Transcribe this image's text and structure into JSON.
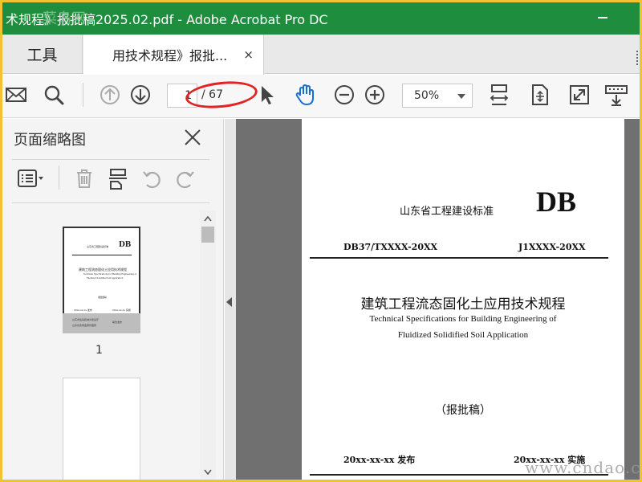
{
  "window": {
    "title": "术规程》报批稿2025.02.pdf - Adobe Acrobat Pro DC"
  },
  "tabs": {
    "tools_label": "工具",
    "doc_label": "用技术规程》报批...",
    "close_glyph": "×"
  },
  "toolbar": {
    "current_page": "1",
    "total_pages": "/ 67",
    "zoom": "50%"
  },
  "sidebar": {
    "title": "页面缩略图",
    "thumbnail_page_number": "1"
  },
  "page": {
    "standard_name": "山东省工程建设标准",
    "db_mark": "DB",
    "code_left": "DB37/TXXXX-20XX",
    "code_right": "J1XXXX-20XX",
    "title_cn": "建筑工程流态固化土应用技术规程",
    "title_en_line1": "Technical Specifications for Building Engineering of",
    "title_en_line2": "Fluidized Solidified Soil  Application",
    "draft_label": "（报批稿）",
    "issue_date": "20xx-xx-xx  发布",
    "impl_date": "20xx-xx-xx  实施"
  },
  "thumbnail": {
    "std_name": "山东省工程建设标准",
    "db_mark": "DB",
    "title_cn": "建筑工程流态固化土应用技术规程",
    "title_en1": "Technical Specifications for Building Engineering of",
    "title_en2": "Fluidized Solidified Soil  Application",
    "draft": "（报批稿）",
    "issue": "20xx-xx-xx 发布",
    "impl": "20xx-xx-xx 实施",
    "footer1": "山东省住房和城乡建设厅",
    "footer2": "山东省市场监督管理局",
    "footer3": "联合发布"
  },
  "watermark": {
    "text": "www.cndao.co",
    "corner_text": "菜鸟网"
  },
  "colors": {
    "titlebar": "#1e8e3e",
    "highlight_ellipse": "#e02424",
    "border": "#f1c232"
  }
}
